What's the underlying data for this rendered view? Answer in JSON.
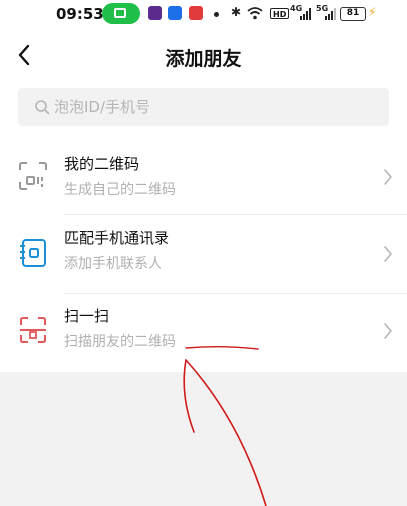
{
  "status_bar": {
    "time": "09:53",
    "battery": "81",
    "net_tag": "HD",
    "signal_tag": "4G",
    "signal_tag_2": "5G"
  },
  "header": {
    "title": "添加朋友"
  },
  "search": {
    "placeholder": "泡泡ID/手机号"
  },
  "items": [
    {
      "title": "我的二维码",
      "subtitle": "生成自己的二维码",
      "icon": "qr-code-icon"
    },
    {
      "title": "匹配手机通讯录",
      "subtitle": "添加手机联系人",
      "icon": "contacts-book-icon"
    },
    {
      "title": "扫一扫",
      "subtitle": "扫描朋友的二维码",
      "icon": "scan-icon"
    }
  ],
  "colors": {
    "cast_pill": "#1fbf4a",
    "contacts_icon": "#1a8fd8",
    "scan_icon": "#e05a5a",
    "annotation": "#d11a1a"
  }
}
